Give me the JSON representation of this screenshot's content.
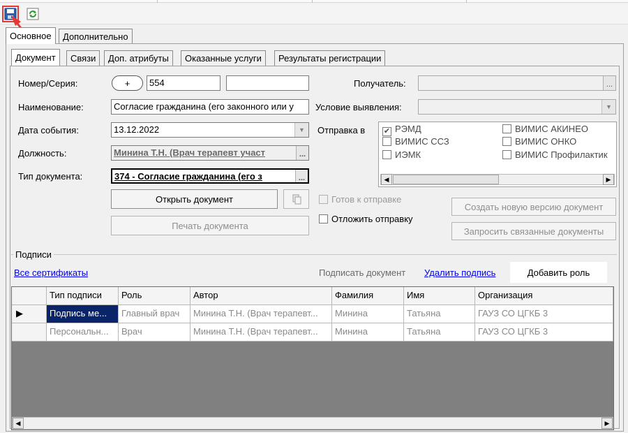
{
  "toolbar": {
    "save_icon": "save-icon",
    "refresh_icon": "refresh-icon"
  },
  "outer_tabs": [
    "Основное",
    "Дополнительно"
  ],
  "doc_tabs": [
    "Документ",
    "Связи",
    "Доп. атрибуты",
    "Оказанные услуги",
    "Результаты регистрации"
  ],
  "form": {
    "number_label": "Номер/Серия:",
    "plus": "+",
    "number": "554",
    "series": "",
    "name_label": "Наименование:",
    "name_value": "Согласие гражданина (его законного или у",
    "date_label": "Дата события:",
    "date_value": "13.12.2022",
    "position_label": "Должность:",
    "position_value": "Минина Т.Н. (Врач терапевт участ",
    "doctype_label": "Тип документа:",
    "doctype_value": "374 - Согласие гражданина (его з",
    "open_doc": "Открыть документ",
    "print_doc": "Печать документа",
    "recipient_label": "Получатель:",
    "condition_label": "Условие выявления:",
    "send_label": "Отправка в",
    "send_options": [
      {
        "label": "РЭМД",
        "checked": true
      },
      {
        "label": "ВИМИС АКИНЕО",
        "checked": false
      },
      {
        "label": "ВИМИС ССЗ",
        "checked": false
      },
      {
        "label": "ВИМИС ОНКО",
        "checked": false
      },
      {
        "label": "ИЭМК",
        "checked": false
      },
      {
        "label": "ВИМИС Профилактик",
        "checked": false
      }
    ],
    "ready": "Готов к отправке",
    "postpone": "Отложить отправку",
    "new_version": "Создать новую версию документ",
    "request_linked": "Запросить связанные документы"
  },
  "signatures": {
    "group_title": "Подписи",
    "all_certs": "Все сертификаты",
    "sign_doc": "Подписать документ",
    "delete_sign": "Удалить подпись",
    "add_role": "Добавить роль",
    "columns": [
      "",
      "Тип подписи",
      "Роль",
      "Автор",
      "Фамилия",
      "Имя",
      "Организация"
    ],
    "rows": [
      {
        "type": "Подпись ме...",
        "role": "Главный врач",
        "author": "Минина Т.Н. (Врач терапевт...",
        "surname": "Минина",
        "name": "Татьяна",
        "org": "ГАУЗ СО ЦГКБ 3"
      },
      {
        "type": "Персональн...",
        "role": "Врач",
        "author": "Минина Т.Н. (Врач терапевт...",
        "surname": "Минина",
        "name": "Татьяна",
        "org": "ГАУЗ СО ЦГКБ 3"
      }
    ]
  },
  "colors": {
    "annotation": "#e53935",
    "selection": "#0a246a",
    "link": "#0000ee"
  }
}
